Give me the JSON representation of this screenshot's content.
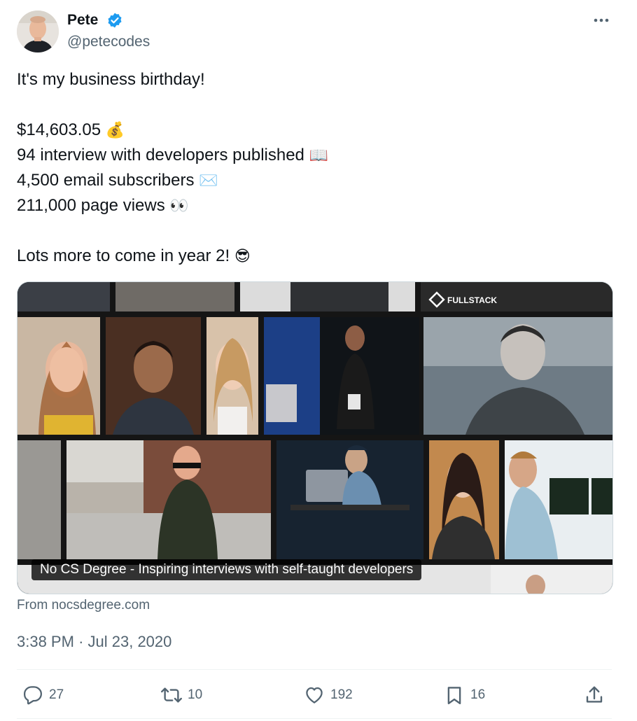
{
  "user": {
    "display_name": "Pete",
    "handle": "@petecodes",
    "verified_icon": "verified-badge-icon",
    "more_icon": "more-options-icon"
  },
  "tweet": {
    "line1": "It's my business birthday!",
    "line2": "$14,603.05",
    "line2_emoji": "💰",
    "line3": "94 interview with developers published",
    "line3_emoji": "📖",
    "line4": "4,500 email subscribers",
    "line4_emoji": "✉️",
    "line5": "211,000 page views",
    "line5_emoji": "👀",
    "line6": "Lots more to come in year 2!",
    "line6_emoji": "😎"
  },
  "card": {
    "caption": "No CS Degree - Inspiring interviews with self-taught developers",
    "source": "From nocsdegree.com",
    "logo_text": "FULLSTACK"
  },
  "timestamp": {
    "time": "3:38 PM",
    "separator": "·",
    "date": "Jul 23, 2020"
  },
  "actions": {
    "replies": "27",
    "retweets": "10",
    "likes": "192",
    "bookmarks": "16"
  },
  "colors": {
    "text": "#0f1419",
    "muted": "#536471",
    "verified": "#1d9bf0",
    "border": "#cfd9de"
  }
}
